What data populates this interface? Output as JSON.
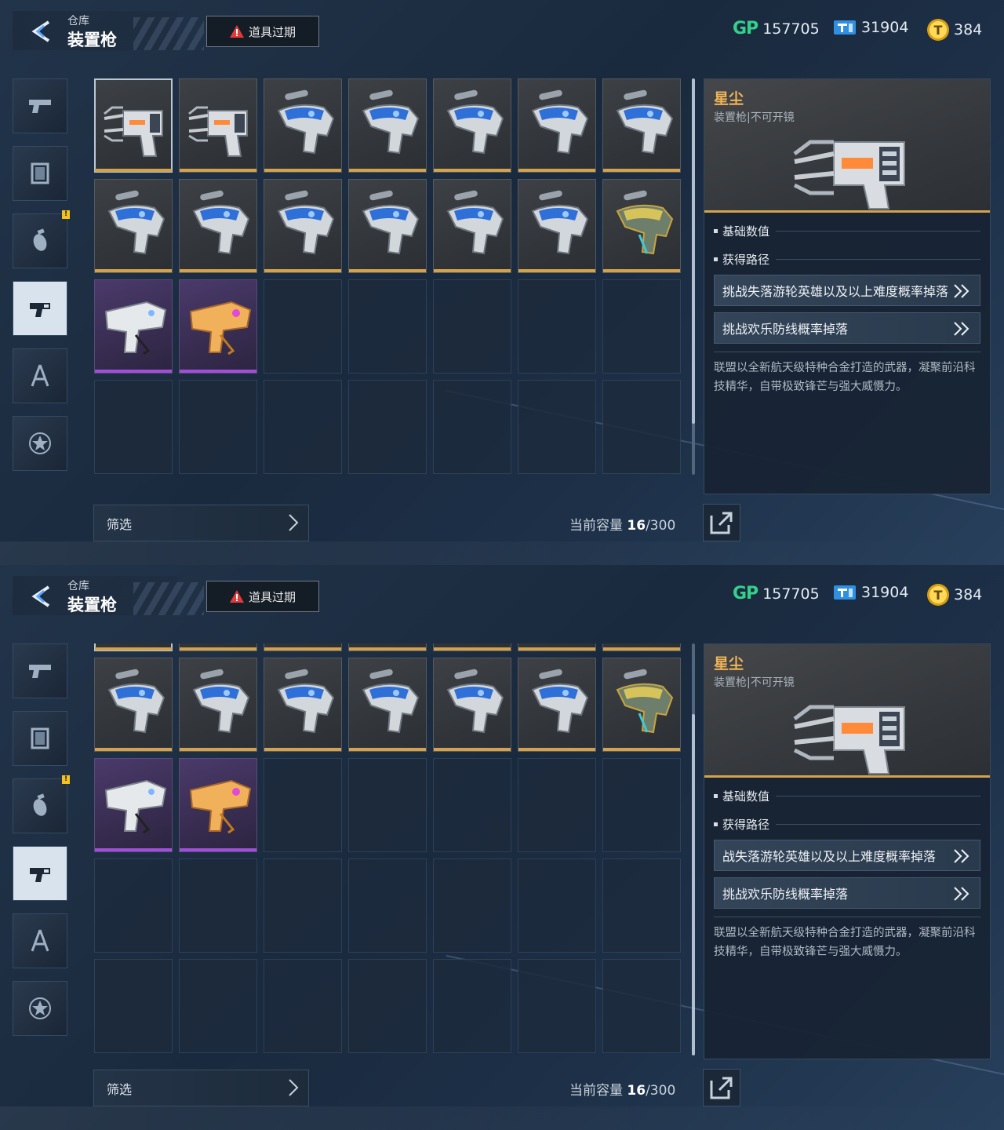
{
  "header": {
    "subtitle": "仓库",
    "title": "装置枪",
    "expire_button": "道具过期"
  },
  "currencies": {
    "gp_icon": "GP",
    "gp_value": "157705",
    "tp_value": "31904",
    "coin_value": "384",
    "gp_color": "#35d08b",
    "coin_color": "#f2c31c"
  },
  "sidebar": {
    "tabs": [
      {
        "icon": "pistol-icon",
        "active": false
      },
      {
        "icon": "frame-icon",
        "active": false
      },
      {
        "icon": "grenade-icon",
        "active": false,
        "badge": "!"
      },
      {
        "icon": "device-gun-icon",
        "active": true
      },
      {
        "icon": "compass-tool-icon",
        "active": false
      },
      {
        "icon": "star-emblem-icon",
        "active": false
      }
    ]
  },
  "inventory": {
    "items": [
      {
        "type": "claw-gun",
        "rarity": "gold",
        "selected": true
      },
      {
        "type": "claw-gun",
        "rarity": "gold"
      },
      {
        "type": "blue-gun",
        "rarity": "gold"
      },
      {
        "type": "blue-gun",
        "rarity": "gold"
      },
      {
        "type": "blue-gun",
        "rarity": "gold"
      },
      {
        "type": "blue-gun",
        "rarity": "gold"
      },
      {
        "type": "blue-gun",
        "rarity": "gold"
      },
      {
        "type": "blue-gun",
        "rarity": "gold"
      },
      {
        "type": "blue-gun",
        "rarity": "gold"
      },
      {
        "type": "blue-gun",
        "rarity": "gold"
      },
      {
        "type": "blue-gun",
        "rarity": "gold"
      },
      {
        "type": "blue-gun",
        "rarity": "gold"
      },
      {
        "type": "blue-gun",
        "rarity": "gold"
      },
      {
        "type": "gold-gun",
        "rarity": "gold"
      },
      {
        "type": "white-pistol",
        "rarity": "purple"
      },
      {
        "type": "orange-pistol",
        "rarity": "purple"
      }
    ],
    "colors": {
      "gold": "#d2a24e",
      "purple": "#a050d8"
    }
  },
  "footer": {
    "filter_label": "筛选",
    "capacity_label": "当前容量",
    "capacity_current": "16",
    "capacity_max": "/300"
  },
  "detail": {
    "name": "星尘",
    "type": "装置枪|不可开镜",
    "section_stats": "基础数值",
    "section_routes": "获得路径",
    "route_1_top": "挑战失落游轮英雄以及以上难度概率掉落",
    "route_1_bottom": "战失落游轮英雄以及以上难度概率掉落",
    "route_2": "挑战欢乐防线概率掉落",
    "description": "联盟以全新航天级特种合金打造的武器，凝聚前沿科技精华，自带极致锋芒与强大威慑力。"
  }
}
